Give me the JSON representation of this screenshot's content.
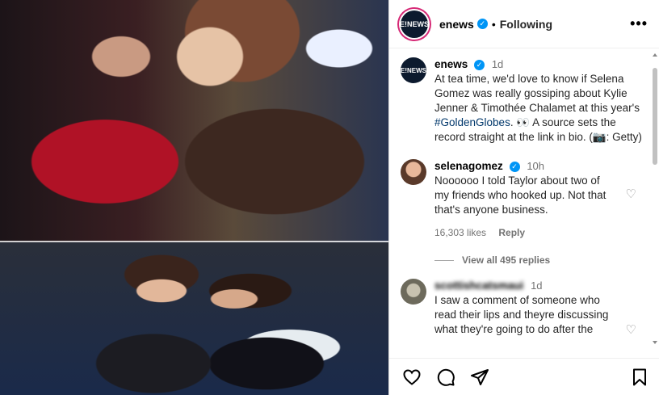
{
  "header": {
    "avatar_text": "E!NEWS",
    "username": "enews",
    "dot": "•",
    "follow_state": "Following",
    "more": "•••"
  },
  "caption": {
    "username": "enews",
    "time": "1d",
    "text_before_tag": "At tea time, we'd love to know if Selena Gomez was really gossiping about Kylie Jenner & Timothée Chalamet at this year's ",
    "hashtag": "#GoldenGlobes",
    "text_after_tag": ". 👀 A source sets the record straight at the link in bio. (📷: Getty)"
  },
  "comments": [
    {
      "username": "selenagomez",
      "time": "10h",
      "text": "Noooooo I told Taylor about two of my friends who hooked up. Not that that's anyone business.",
      "likes": "16,303 likes",
      "reply": "Reply",
      "view_replies": "View all 495 replies"
    },
    {
      "username": "scottishcatsmaui",
      "time": "1d",
      "text": "I saw a comment of someone who read their lips and theyre discussing what they're going to do after the"
    }
  ],
  "icons": {
    "verified": "verified-badge",
    "like": "heart-icon",
    "comment": "comment-icon",
    "share": "share-icon",
    "save": "bookmark-icon"
  },
  "colors": {
    "verified": "#0095f6",
    "hashtag": "#00376b",
    "ring": "#d62976"
  }
}
